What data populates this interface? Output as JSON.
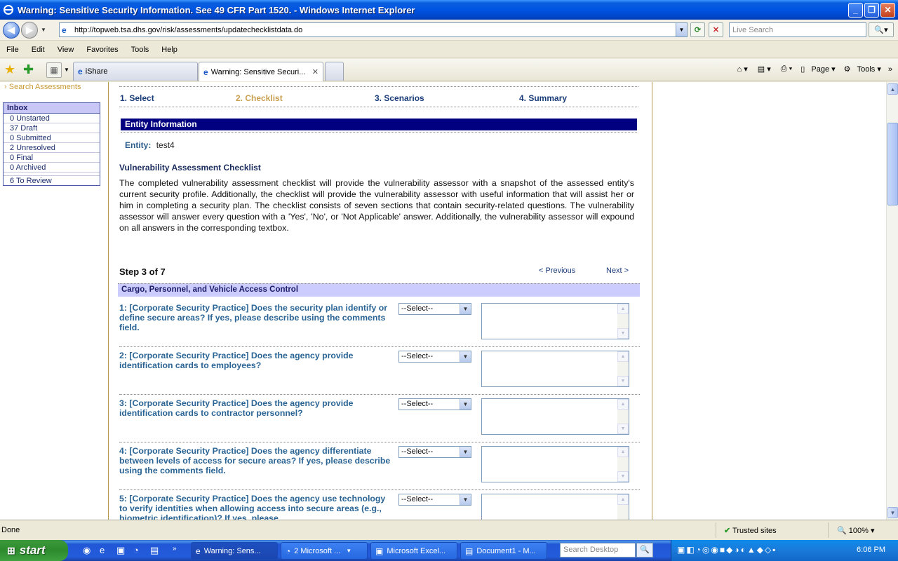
{
  "window": {
    "title": "Warning: Sensitive Security Information. See 49 CFR Part 1520. - Windows Internet Explorer"
  },
  "address": {
    "url": "http://topweb.tsa.dhs.gov/risk/assessments/updatechecklistdata.do",
    "search_placeholder": "Live Search"
  },
  "menu": [
    "File",
    "Edit",
    "View",
    "Favorites",
    "Tools",
    "Help"
  ],
  "tabs": [
    {
      "label": "iShare"
    },
    {
      "label": "Warning: Sensitive Securi..."
    }
  ],
  "command_bar": {
    "page_label": "Page",
    "tools_label": "Tools"
  },
  "sidebar": {
    "search_link": "Search Assessments",
    "inbox_title": "Inbox",
    "items": [
      {
        "label": "0 Unstarted"
      },
      {
        "label": "37 Draft"
      },
      {
        "label": "0 Submitted"
      },
      {
        "label": "2 Unresolved"
      },
      {
        "label": "0 Final"
      },
      {
        "label": "0 Archived"
      },
      {
        "label": "6 To Review"
      }
    ]
  },
  "wizard": {
    "steps": [
      "1. Select",
      "2. Checklist",
      "3. Scenarios",
      "4. Summary"
    ]
  },
  "entity": {
    "header": "Entity Information",
    "label": "Entity:",
    "value": "test4"
  },
  "checklist": {
    "title": "Vulnerability Assessment Checklist",
    "description": "The completed vulnerability assessment checklist will provide the vulnerability assessor with a snapshot of the assessed entity's current security profile. Additionally, the checklist will provide the vulnerability assessor with useful information that will assist her or him in completing a security plan. The checklist consists of seven sections that contain security-related questions. The vulnerability assessor will answer every question with a 'Yes', 'No', or 'Not Applicable' answer. Additionally, the vulnerability assessor will expound on all answers in the corresponding textbox.",
    "step_label": "Step 3 of 7",
    "prev_label": "< Previous",
    "next_label": "Next >",
    "section_title": "Cargo, Personnel, and Vehicle Access Control",
    "select_default": "--Select--",
    "questions": [
      {
        "text": "1: [Corporate Security Practice] Does the security plan identify or define secure areas? If yes, please describe using the comments field."
      },
      {
        "text": "2: [Corporate Security Practice] Does the agency provide identification cards to employees?"
      },
      {
        "text": "3: [Corporate Security Practice] Does the agency provide identification cards to contractor personnel?"
      },
      {
        "text": "4: [Corporate Security Practice] Does the agency differentiate between levels of access for secure areas? If yes, please describe using the comments field."
      },
      {
        "text": "5: [Corporate Security Practice] Does the agency use technology to verify identities when allowing access into secure areas (e.g., biometric identification)? If yes, please"
      }
    ]
  },
  "status": {
    "left": "Done",
    "zone": "Trusted sites",
    "zoom": "100%"
  },
  "taskbar": {
    "start": "start",
    "buttons": [
      {
        "label": "Warning: Sens..."
      },
      {
        "label": "2 Microsoft ..."
      },
      {
        "label": "Microsoft Excel..."
      },
      {
        "label": "Document1 - M..."
      }
    ],
    "search_placeholder": "Search Desktop",
    "clock": "6:06 PM"
  }
}
